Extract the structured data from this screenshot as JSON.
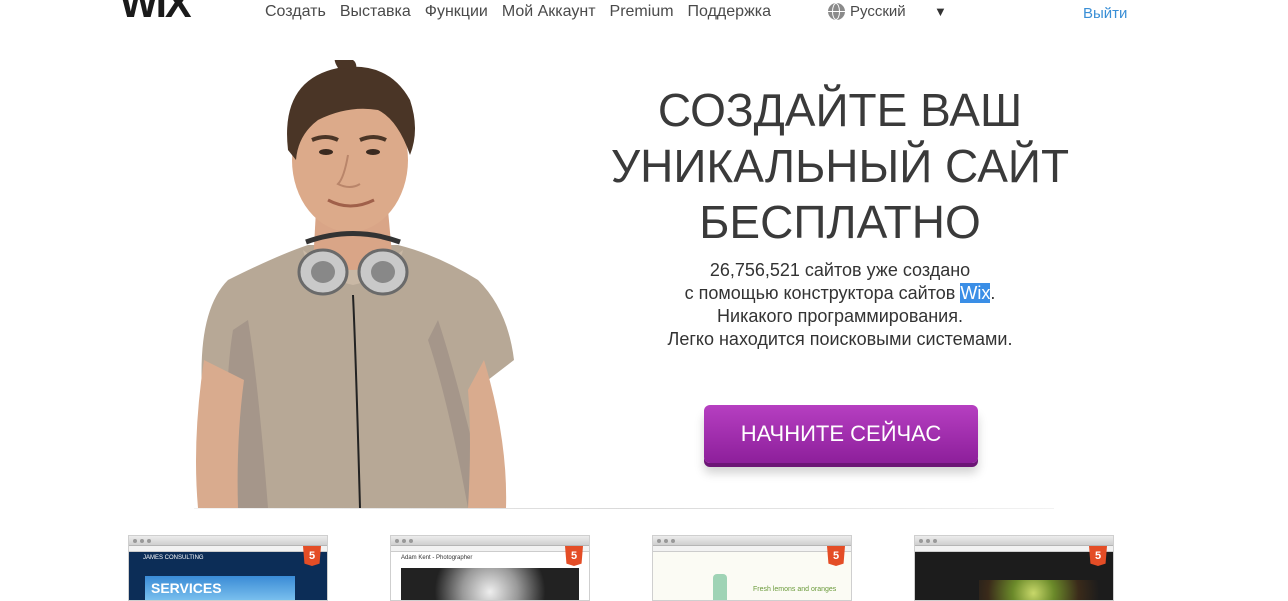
{
  "header": {
    "logo_text": "WIX",
    "nav": [
      "Создать",
      "Выставка",
      "Функции",
      "Мой Аккаунт",
      "Premium",
      "Поддержка"
    ],
    "language": "Русский",
    "logout": "Выйти"
  },
  "hero": {
    "title_lines": [
      "СОЗДАЙТЕ ВАШ",
      "УНИКАЛЬНЫЙ САЙТ",
      "БЕСПЛАТНО"
    ],
    "subtitle": {
      "line1": "26,756,521 сайтов уже создано",
      "line2_before": "с помощью конструктора сайтов ",
      "line2_highlight": "Wix",
      "line2_after": ".",
      "line3": "Никакого программирования.",
      "line4": "Легко находится поисковыми системами."
    },
    "cta": "НАЧНИТЕ СЕЙЧАС"
  },
  "templates": [
    {
      "brand": "JAMES CONSULTING",
      "headline": "SERVICES",
      "badge": "5"
    },
    {
      "name": "Adam Kent - Photographer",
      "badge": "5"
    },
    {
      "text": "Fresh lemons and oranges",
      "badge": "5"
    },
    {
      "badge": "5"
    }
  ],
  "colors": {
    "cta": "#9a2aa8",
    "link": "#3a8fd6",
    "highlight": "#3a8ee6"
  }
}
